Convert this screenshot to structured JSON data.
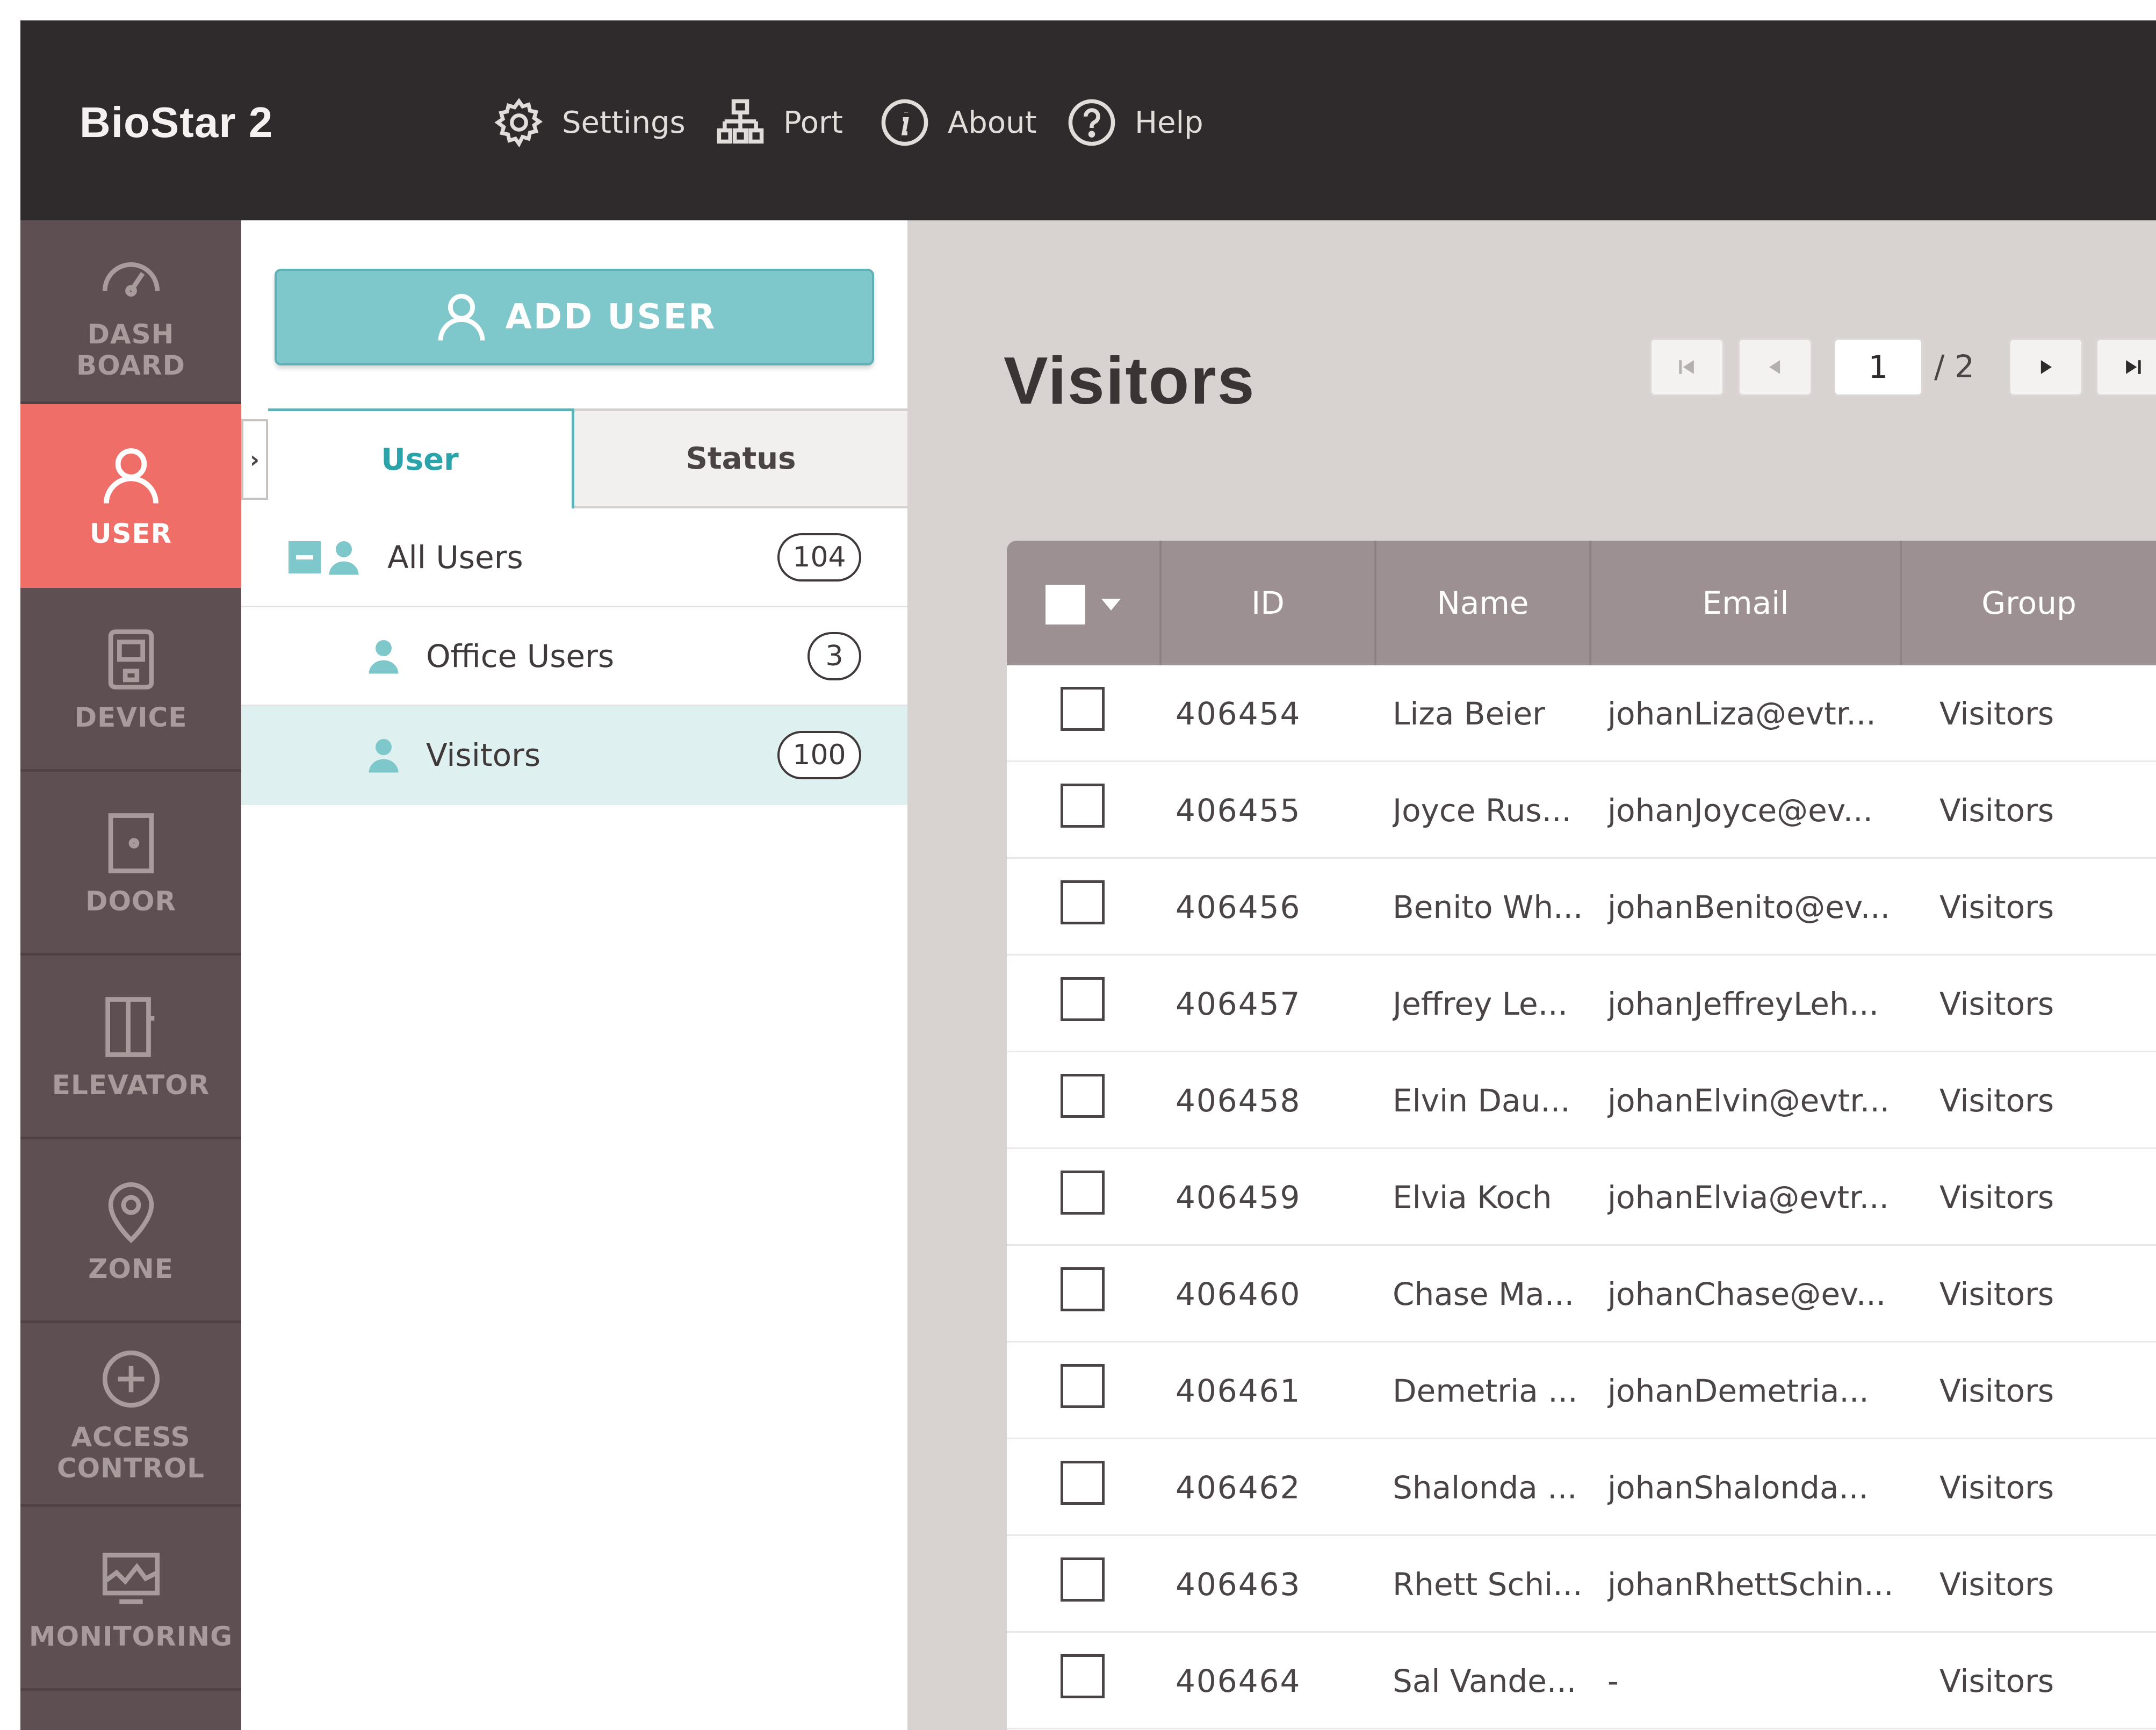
{
  "app": {
    "brand": "BioStar 2"
  },
  "topnav": {
    "settings": "Settings",
    "port": "Port",
    "about": "About",
    "help": "Help"
  },
  "sidebar": {
    "items": [
      {
        "label": "DASH\nBOARD",
        "icon": "dashboard-icon"
      },
      {
        "label": "USER",
        "icon": "user-icon",
        "active": true
      },
      {
        "label": "DEVICE",
        "icon": "device-icon"
      },
      {
        "label": "DOOR",
        "icon": "door-icon"
      },
      {
        "label": "ELEVATOR",
        "icon": "elevator-icon"
      },
      {
        "label": "ZONE",
        "icon": "zone-pin-icon"
      },
      {
        "label": "ACCESS\nCONTROL",
        "icon": "access-control-icon"
      },
      {
        "label": "MONITORING",
        "icon": "monitoring-icon"
      }
    ]
  },
  "panel": {
    "add_user": "ADD USER",
    "tabs": {
      "user": "User",
      "status": "Status"
    },
    "groups": [
      {
        "label": "All Users",
        "count": "104"
      },
      {
        "label": "Office Users",
        "count": "3"
      },
      {
        "label": "Visitors",
        "count": "100"
      }
    ]
  },
  "main": {
    "title": "Visitors",
    "pager": {
      "current": "1",
      "total": "/ 2"
    },
    "columns": {
      "id": "ID",
      "name": "Name",
      "email": "Email",
      "group": "Group"
    },
    "rows": [
      {
        "id": "406454",
        "name": "Liza Beier",
        "email": "johanLiza@evtr...",
        "group": "Visitors"
      },
      {
        "id": "406455",
        "name": "Joyce Rus...",
        "email": "johanJoyce@ev...",
        "group": "Visitors"
      },
      {
        "id": "406456",
        "name": "Benito Wh...",
        "email": "johanBenito@ev...",
        "group": "Visitors"
      },
      {
        "id": "406457",
        "name": "Jeffrey Le...",
        "email": "johanJeffreyLeh...",
        "group": "Visitors"
      },
      {
        "id": "406458",
        "name": "Elvin Dau...",
        "email": "johanElvin@evtr...",
        "group": "Visitors"
      },
      {
        "id": "406459",
        "name": "Elvia Koch",
        "email": "johanElvia@evtr...",
        "group": "Visitors"
      },
      {
        "id": "406460",
        "name": "Chase Ma...",
        "email": "johanChase@ev...",
        "group": "Visitors"
      },
      {
        "id": "406461",
        "name": "Demetria ...",
        "email": "johanDemetria...",
        "group": "Visitors"
      },
      {
        "id": "406462",
        "name": "Shalonda ...",
        "email": "johanShalonda...",
        "group": "Visitors"
      },
      {
        "id": "406463",
        "name": "Rhett Schi...",
        "email": "johanRhettSchin...",
        "group": "Visitors"
      },
      {
        "id": "406464",
        "name": "Sal Vande...",
        "email": "-",
        "group": "Visitors"
      }
    ]
  },
  "colors": {
    "topbar": "#2f2a2b",
    "sidebar": "#5e5052",
    "sidebar_active": "#ef6f68",
    "accent": "#7ec8cc",
    "table_header": "#9d9092",
    "selected_row": "#dff0f0"
  }
}
